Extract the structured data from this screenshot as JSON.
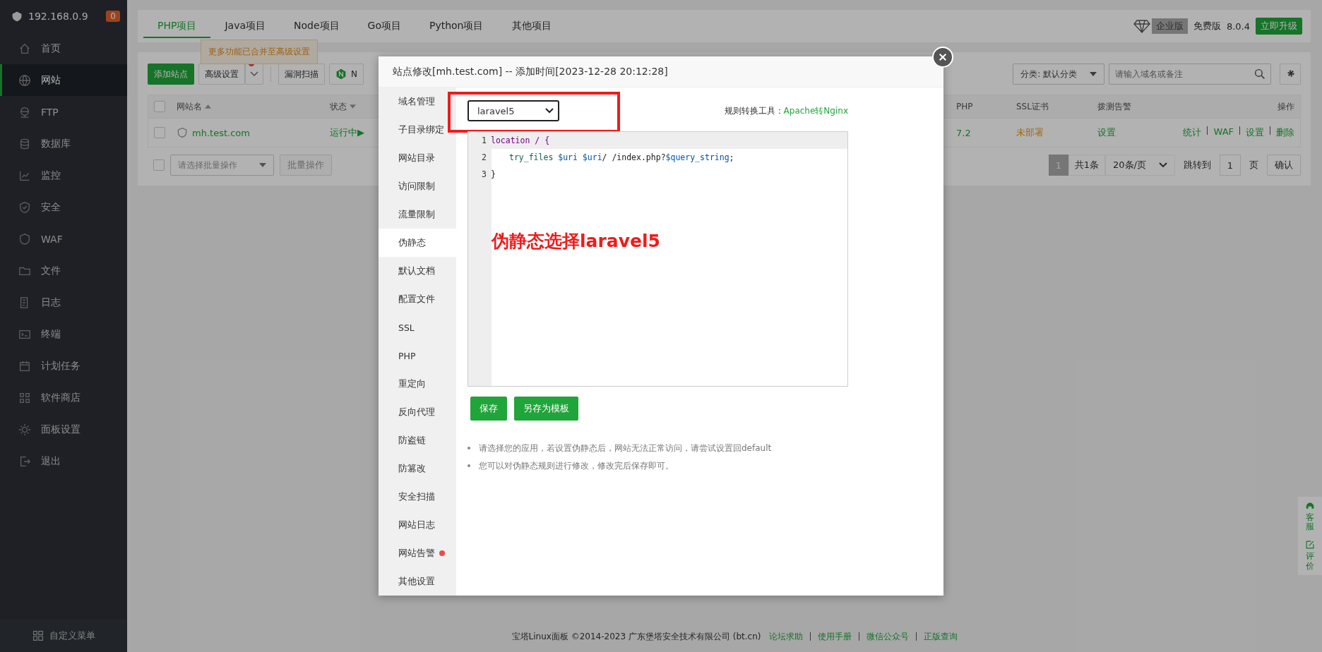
{
  "sidebar": {
    "host": "192.168.0.9",
    "badge": "0",
    "items": [
      {
        "label": "首页",
        "selected": false
      },
      {
        "label": "网站",
        "selected": true
      },
      {
        "label": "FTP",
        "selected": false
      },
      {
        "label": "数据库",
        "selected": false
      },
      {
        "label": "监控",
        "selected": false
      },
      {
        "label": "安全",
        "selected": false
      },
      {
        "label": "WAF",
        "selected": false
      },
      {
        "label": "文件",
        "selected": false
      },
      {
        "label": "日志",
        "selected": false
      },
      {
        "label": "终端",
        "selected": false
      },
      {
        "label": "计划任务",
        "selected": false
      },
      {
        "label": "软件商店",
        "selected": false
      },
      {
        "label": "面板设置",
        "selected": false
      },
      {
        "label": "退出",
        "selected": false
      }
    ],
    "footer": "自定义菜单"
  },
  "project_tabs": [
    {
      "label": "PHP项目",
      "selected": true
    },
    {
      "label": "Java项目",
      "selected": false
    },
    {
      "label": "Node项目",
      "selected": false
    },
    {
      "label": "Go项目",
      "selected": false
    },
    {
      "label": "Python项目",
      "selected": false
    },
    {
      "label": "其他项目",
      "selected": false
    }
  ],
  "edition": {
    "enterprise": "企业版",
    "free": "免费版",
    "version": "8.0.4",
    "upgrade": "立即升级"
  },
  "tooltip": "更多功能已合并至高级设置",
  "toolbar": {
    "add": "添加站点",
    "advanced": "高级设置",
    "advanced_alert": true,
    "scan": "漏洞扫描",
    "nginx": "N",
    "category": "分类: 默认分类",
    "search_placeholder": "请输入域名或备注"
  },
  "table": {
    "select_all": false,
    "columns": [
      "网站名",
      "状态",
      "PHP",
      "SSL证书",
      "拨测告警",
      "操作"
    ],
    "rows": [
      {
        "checked": false,
        "name": "mh.test.com",
        "status": "运行中▶",
        "php": "7.2",
        "ssl": "未部署",
        "monitor": "设置",
        "actions": [
          "统计",
          "WAF",
          "设置",
          "删除"
        ]
      }
    ]
  },
  "batch": {
    "checked": false,
    "placeholder": "请选择批量操作",
    "button": "批量操作"
  },
  "pagination": {
    "page": "1",
    "total": "共1条",
    "per_page": "20条/页",
    "goto": "跳转到",
    "goto_value": "1",
    "unit": "页",
    "confirm": "确认"
  },
  "footer": {
    "copyright": "宝塔Linux面板 ©2014-2023 广东堡塔安全技术有限公司 (bt.cn)",
    "links": [
      "论坛求助",
      "使用手册",
      "微信公众号",
      "正版查询"
    ]
  },
  "float_panel": [
    "客服",
    "评价"
  ],
  "dialog": {
    "title": "站点修改[mh.test.com] -- 添加时间[2023-12-28 20:12:28]",
    "nav": [
      {
        "label": "域名管理",
        "selected": false,
        "alert": false
      },
      {
        "label": "子目录绑定",
        "selected": false,
        "alert": false
      },
      {
        "label": "网站目录",
        "selected": false,
        "alert": false
      },
      {
        "label": "访问限制",
        "selected": false,
        "alert": false
      },
      {
        "label": "流量限制",
        "selected": false,
        "alert": false
      },
      {
        "label": "伪静态",
        "selected": true,
        "alert": false
      },
      {
        "label": "默认文档",
        "selected": false,
        "alert": false
      },
      {
        "label": "配置文件",
        "selected": false,
        "alert": false
      },
      {
        "label": "SSL",
        "selected": false,
        "alert": false
      },
      {
        "label": "PHP",
        "selected": false,
        "alert": false
      },
      {
        "label": "重定向",
        "selected": false,
        "alert": false
      },
      {
        "label": "反向代理",
        "selected": false,
        "alert": false
      },
      {
        "label": "防盗链",
        "selected": false,
        "alert": false
      },
      {
        "label": "防篡改",
        "selected": false,
        "alert": false
      },
      {
        "label": "安全扫描",
        "selected": false,
        "alert": false
      },
      {
        "label": "网站日志",
        "selected": false,
        "alert": false
      },
      {
        "label": "网站告警",
        "selected": false,
        "alert": true
      },
      {
        "label": "其他设置",
        "selected": false,
        "alert": false
      }
    ],
    "rule_select": "laravel5",
    "converter_label": "规则转换工具：",
    "converter_link": "Apache转Nginx",
    "code": [
      {
        "number": "1",
        "tokens": [
          {
            "text": "location / {",
            "kind": "keyword"
          }
        ]
      },
      {
        "number": "2",
        "tokens": [
          {
            "text": "try_files ",
            "kind": "directive"
          },
          {
            "text": "$uri $uri",
            "kind": "variable"
          },
          {
            "text": "/ /index.php?",
            "kind": "plain"
          },
          {
            "text": "$query_string",
            "kind": "variable"
          },
          {
            "text": ";",
            "kind": "plain"
          }
        ]
      },
      {
        "number": "3",
        "tokens": [
          {
            "text": "}",
            "kind": "plain"
          }
        ]
      }
    ],
    "annotation": "伪静态选择laravel5",
    "buttons": [
      "保存",
      "另存为模板"
    ],
    "notes": [
      "请选择您的应用，若设置伪静态后，网站无法正常访问，请尝试设置回default",
      "您可以对伪静态规则进行修改，修改完后保存即可。"
    ]
  }
}
